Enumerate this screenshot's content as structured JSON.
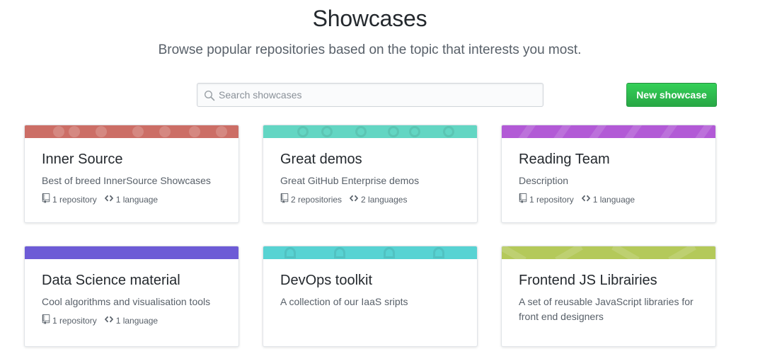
{
  "header": {
    "title": "Showcases",
    "subtitle": "Browse popular repositories based on the topic that interests you most."
  },
  "search": {
    "placeholder": "Search showcases",
    "value": ""
  },
  "actions": {
    "new_showcase_label": "New showcase"
  },
  "colors": {
    "inner_source": "#cc6e66",
    "great_demos": "#63d6c3",
    "reading_team": "#b25ad6",
    "data_science": "#6d5bd6",
    "devops": "#58d3d3",
    "frontend": "#b4c95a",
    "button_green": "#28a745"
  },
  "cards": [
    {
      "title": "Inner Source",
      "description": "Best of breed InnerSource Showcases",
      "repos": "1 repository",
      "languages": "1 language"
    },
    {
      "title": "Great demos",
      "description": "Great GitHub Enterprise demos",
      "repos": "2 repositories",
      "languages": "2 languages"
    },
    {
      "title": "Reading Team",
      "description": "Description",
      "repos": "1 repository",
      "languages": "1 language"
    },
    {
      "title": "Data Science material",
      "description": "Cool algorithms and visualisation tools",
      "repos": "1 repository",
      "languages": "1 language"
    },
    {
      "title": "DevOps toolkit",
      "description": "A collection of our IaaS sripts"
    },
    {
      "title": "Frontend JS Librairies",
      "description": "A set of reusable JavaScript libraries for front end designers"
    }
  ],
  "icons": {
    "repo": "repo-icon",
    "code": "code-icon",
    "search": "search-icon"
  }
}
